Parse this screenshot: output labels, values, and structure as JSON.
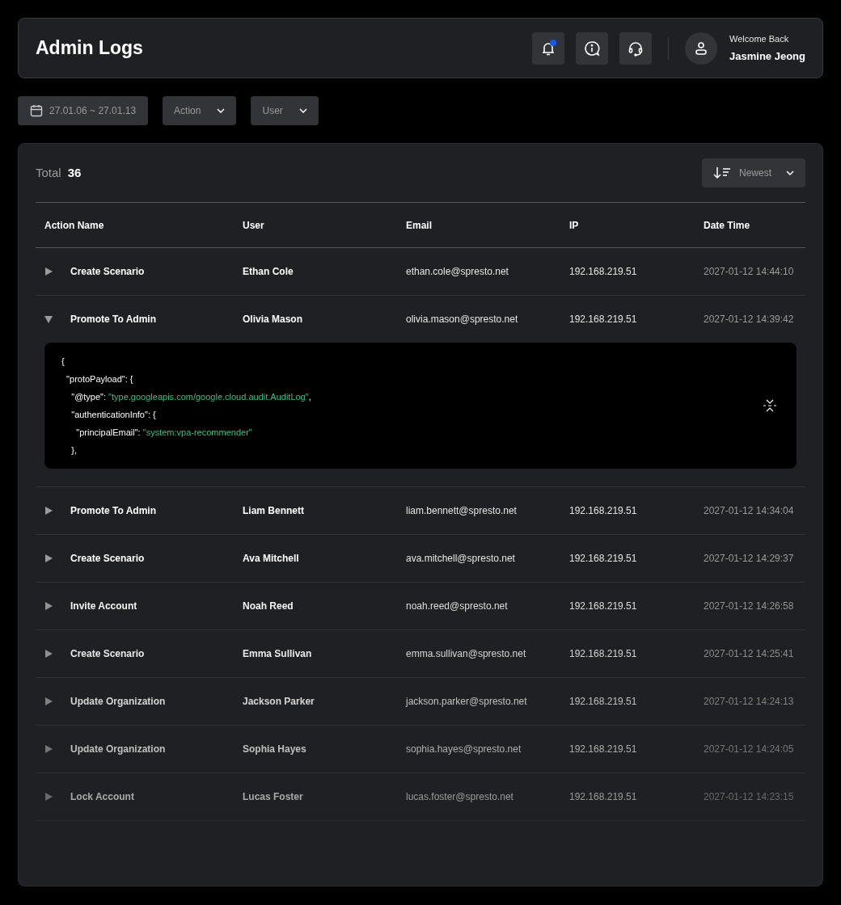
{
  "header": {
    "title": "Admin Logs",
    "notifications": {
      "unread": true
    },
    "user": {
      "greeting": "Welcome Back",
      "name": "Jasmine Jeong"
    }
  },
  "filters": [
    {
      "kind": "date",
      "label": "27.01.06 ~ 27.01.13"
    },
    {
      "kind": "dropdown",
      "label": "Action"
    },
    {
      "kind": "dropdown",
      "label": "User"
    }
  ],
  "summary": {
    "label": "Total",
    "count": "36"
  },
  "sort": {
    "label": "Newest"
  },
  "table": {
    "columns": [
      "Action Name",
      "User",
      "Email",
      "IP",
      "Date Time"
    ],
    "rows": [
      {
        "action": "Create Scenario",
        "user": "Ethan Cole",
        "email": "ethan.cole@spresto.net",
        "ip": "192.168.219.51",
        "time": "2027-01-12 14:44:10",
        "expanded": false
      },
      {
        "action": "Promote To Admin",
        "user": "Olivia Mason",
        "email": "olivia.mason@spresto.net",
        "ip": "192.168.219.51",
        "time": "2027-01-12 14:39:42",
        "expanded": true,
        "payload": [
          {
            "text": "{"
          },
          {
            "text": "  \"protoPayload\": {"
          },
          {
            "text": "    \"@type\": ",
            "value": "\"type.googleapis.com/google.cloud.audit.AuditLog\"",
            "tail": ","
          },
          {
            "text": "    \"authenticationInfo\": {"
          },
          {
            "text": "      \"principalEmail\": ",
            "value": "\"system:vpa-recommender\""
          },
          {
            "text": "    },"
          }
        ]
      },
      {
        "action": "Promote To Admin",
        "user": "Liam Bennett",
        "email": "liam.bennett@spresto.net",
        "ip": "192.168.219.51",
        "time": "2027-01-12 14:34:04",
        "expanded": false
      },
      {
        "action": "Create Scenario",
        "user": "Ava Mitchell",
        "email": "ava.mitchell@spresto.net",
        "ip": "192.168.219.51",
        "time": "2027-01-12 14:29:37",
        "expanded": false
      },
      {
        "action": "Invite Account",
        "user": "Noah Reed",
        "email": "noah.reed@spresto.net",
        "ip": "192.168.219.51",
        "time": "2027-01-12 14:26:58",
        "expanded": false
      },
      {
        "action": "Create Scenario",
        "user": "Emma Sullivan",
        "email": "emma.sullivan@spresto.net",
        "ip": "192.168.219.51",
        "time": "2027-01-12 14:25:41",
        "expanded": false
      },
      {
        "action": "Update Organization",
        "user": "Jackson Parker",
        "email": "jackson.parker@spresto.net",
        "ip": "192.168.219.51",
        "time": "2027-01-12 14:24:13",
        "expanded": false
      },
      {
        "action": "Update Organization",
        "user": "Sophia Hayes",
        "email": "sophia.hayes@spresto.net",
        "ip": "192.168.219.51",
        "time": "2027-01-12 14:24:05",
        "expanded": false
      },
      {
        "action": "Lock Account",
        "user": "Lucas Foster",
        "email": "lucas.foster@spresto.net",
        "ip": "192.168.219.51",
        "time": "2027-01-12 14:23:15",
        "expanded": false
      }
    ]
  }
}
